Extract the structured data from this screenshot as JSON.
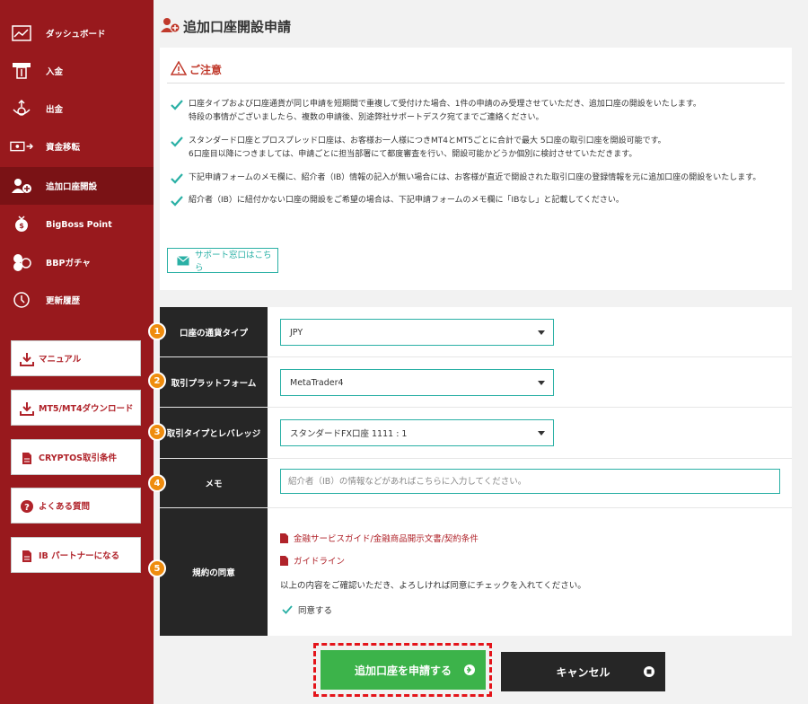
{
  "sidebar": {
    "nav": [
      {
        "label": "ダッシュボード",
        "icon": "chart-board-icon"
      },
      {
        "label": "入金",
        "icon": "deposit-icon"
      },
      {
        "label": "出金",
        "icon": "withdraw-icon"
      },
      {
        "label": "資金移転",
        "icon": "transfer-icon"
      },
      {
        "label": "追加口座開設",
        "icon": "add-account-icon"
      },
      {
        "label": "BigBoss Point",
        "icon": "point-icon"
      },
      {
        "label": "BBPガチャ",
        "icon": "gacha-icon"
      },
      {
        "label": "更新履歴",
        "icon": "history-icon"
      }
    ],
    "buttons": [
      {
        "label": "マニュアル",
        "icon": "download-icon"
      },
      {
        "label": "MT5/MT4ダウンロード",
        "icon": "download-icon"
      },
      {
        "label": "CRYPTOS取引条件",
        "icon": "document-icon"
      },
      {
        "label": "よくある質問",
        "icon": "question-icon"
      },
      {
        "label": "IB パートナーになる",
        "icon": "document-icon"
      }
    ]
  },
  "page": {
    "title": "追加口座開設申請"
  },
  "notice": {
    "title": "ご注意",
    "items": [
      {
        "line1": "口座タイプおよび口座通貨が同じ申請を短期間で重複して受付けた場合、1件の申請のみ受理させていただき、追加口座の開設をいたします。",
        "line2": "特段の事情がございましたら、複数の申請後、別途弊社サポートデスク宛てまでご連絡ください。"
      },
      {
        "line1": "スタンダード口座とプロスプレッド口座は、お客様お一人様につきMT4とMT5ごとに合計で最大 5口座の取引口座を開設可能です。",
        "line2": "6口座目以降につきましては、申請ごとに担当部署にて都度審査を行い、開設可能かどうか個別に検討させていただきます。"
      },
      {
        "line1": "下記申請フォームのメモ欄に、紹介者（IB）情報の記入が無い場合には、お客様が直近で開設された取引口座の登録情報を元に追加口座の開設をいたします。",
        "line2": ""
      },
      {
        "line1": "紹介者（IB）に紐付かない口座の開設をご希望の場合は、下記申請フォームのメモ欄に「IBなし」と記載してください。",
        "line2": ""
      }
    ],
    "support_label": "サポート窓口はこちら"
  },
  "form": {
    "currency": {
      "step": "1",
      "label": "口座の通貨タイプ",
      "value": "JPY"
    },
    "platform": {
      "step": "2",
      "label": "取引プラットフォーム",
      "value": "MetaTrader4"
    },
    "leverage": {
      "step": "3",
      "label": "取引タイプとレバレッジ",
      "value": "スタンダードFX口座 1111 : 1"
    },
    "memo": {
      "step": "4",
      "label": "メモ",
      "placeholder": "紹介者（IB）の情報などがあればこちらに入力してください。"
    },
    "terms": {
      "step": "5",
      "label": "規約の同意",
      "link1": "金融サービスガイド/金融商品開示文書/契約条件",
      "link2": "ガイドライン",
      "text": "以上の内容をご確認いただき、よろしければ同意にチェックを入れてください。",
      "agree_label": "同意する"
    }
  },
  "actions": {
    "submit_label": "追加口座を申請する",
    "cancel_label": "キャンセル"
  },
  "colors": {
    "sidebar": "#98191d",
    "accent_teal": "#2ab0a5",
    "step_orange": "#ef8c0e",
    "submit_green": "#3cb34a",
    "dark": "#262626"
  }
}
